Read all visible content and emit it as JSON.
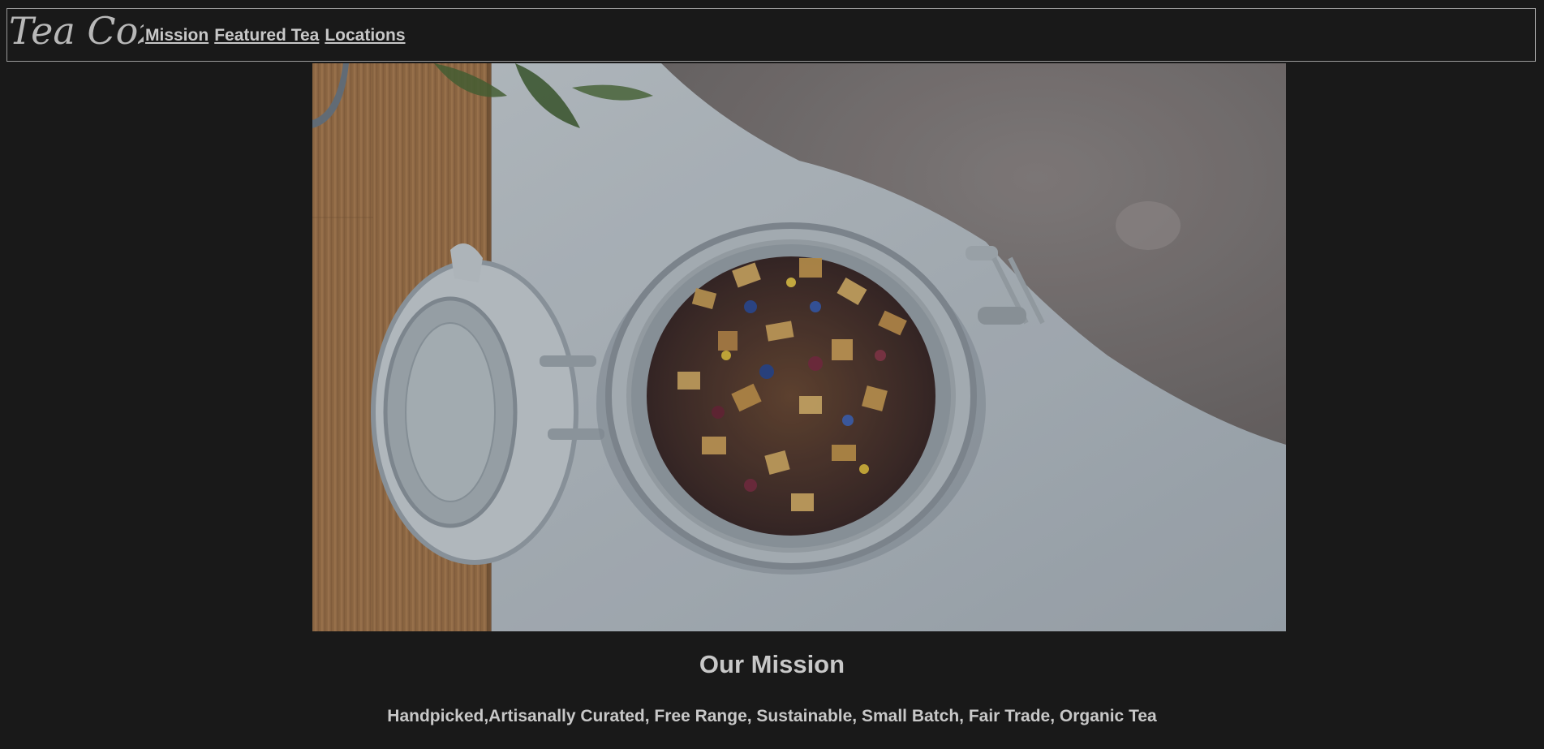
{
  "header": {
    "logo_text": "Tea Cozy",
    "nav": [
      {
        "label": "Mission"
      },
      {
        "label": "Featured Tea"
      },
      {
        "label": "Locations"
      }
    ]
  },
  "hero": {
    "image_subject": "open glass jar of loose leaf tea on white surface beside wooden board and grey knit blanket"
  },
  "mission": {
    "title": "Our Mission",
    "text": "Handpicked,Artisanally Curated, Free Range, Sustainable, Small Batch, Fair Trade, Organic Tea"
  },
  "colors": {
    "background": "#191919",
    "text": "#c8c8c8",
    "border": "#9a9a9a"
  }
}
